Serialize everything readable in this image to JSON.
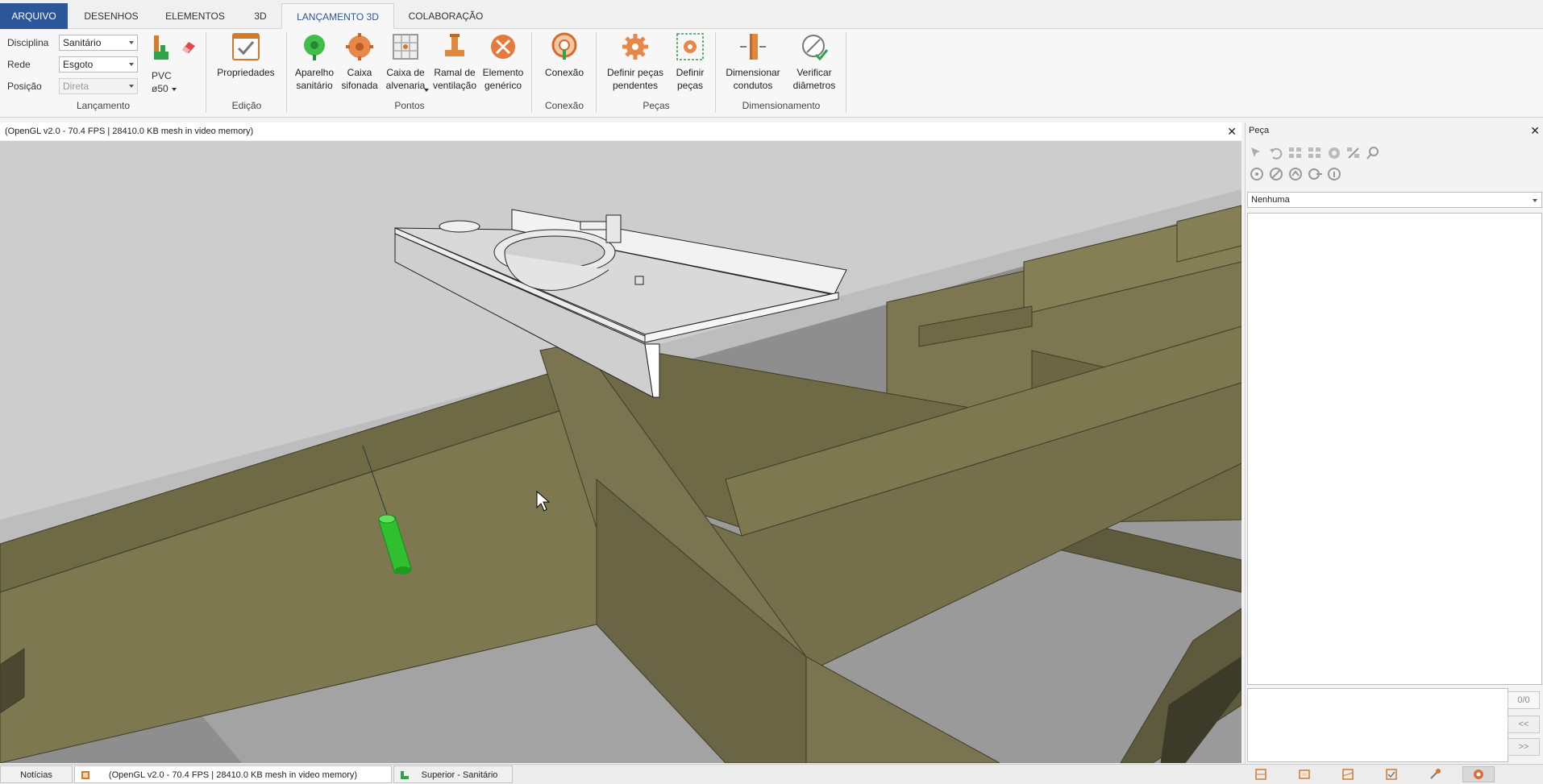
{
  "tabs": [
    {
      "label": "ARQUIVO"
    },
    {
      "label": "DESENHOS"
    },
    {
      "label": "ELEMENTOS"
    },
    {
      "label": "3D"
    },
    {
      "label": "LANÇAMENTO 3D"
    },
    {
      "label": "COLABORAÇÃO"
    }
  ],
  "ribbon": {
    "lancamento": {
      "disciplina_label": "Disciplina",
      "disciplina_value": "Sanitário",
      "rede_label": "Rede",
      "rede_value": "Esgoto",
      "posicao_label": "Posição",
      "posicao_value": "Direta",
      "material": "PVC",
      "diameter": "ø50",
      "group_label": "Lançamento"
    },
    "edicao": {
      "propriedades": "Propriedades",
      "group_label": "Edição"
    },
    "pontos": {
      "aparelho": "Aparelho\nsanitário",
      "caixa_sifonada": "Caixa\nsifonada",
      "caixa_alvenaria": "Caixa de\nalvenaria",
      "ramal": "Ramal de\nventilação",
      "elemento": "Elemento\ngenérico",
      "group_label": "Pontos"
    },
    "conexao": {
      "conexao": "Conexão",
      "group_label": "Conexão"
    },
    "pecas": {
      "definir_pendentes": "Definir peças\npendentes",
      "definir": "Definir\npeças",
      "group_label": "Peças"
    },
    "dimensionamento": {
      "dimensionar": "Dimensionar\ncondutos",
      "verificar": "Verificar\ndiâmetros",
      "group_label": "Dimensionamento"
    }
  },
  "viewport": {
    "header": "(OpenGL v2.0 - 70.4 FPS | 28410.0 KB mesh in video memory)"
  },
  "panel": {
    "title": "Peça",
    "combo_value": "Nenhuma",
    "counter": "0/0",
    "prev": "<<",
    "next": ">>"
  },
  "statusbar": {
    "noticias": "Notícias",
    "view_tab": "(OpenGL v2.0 - 70.4 FPS | 28410.0 KB mesh in video memory)",
    "sheet_tab": "Superior - Sanitário"
  },
  "colors": {
    "file_tab": "#2b579a",
    "beam": "#6e6a46",
    "pipe": "#2fbf2f"
  }
}
